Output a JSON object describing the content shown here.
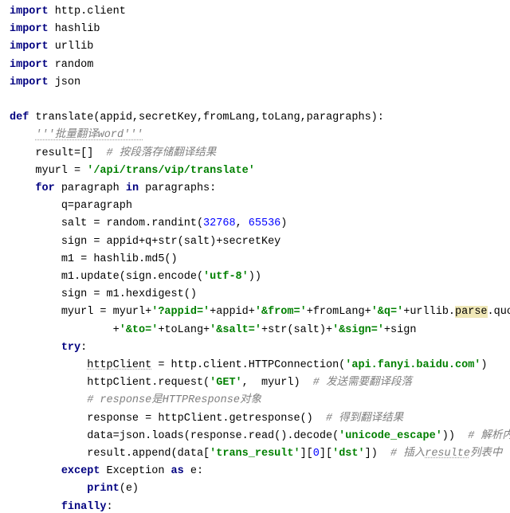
{
  "c": {
    "imp1_kw": "import",
    "imp1_m": " http.client",
    "imp2_kw": "import",
    "imp2_m": " hashlib",
    "imp3_kw": "import",
    "imp3_m": " urllib",
    "imp4_kw": "import",
    "imp4_m": " random",
    "imp5_kw": "import",
    "imp5_m": " json",
    "def_kw": "def",
    "def_sig": " translate(appid,secretKey,fromLang,toLang,paragraphs):",
    "doc": "'''批量翻译word'''",
    "res_l": "result=[]  ",
    "res_c": "# 按段落存储翻译结果",
    "myurl_l": "myurl = ",
    "myurl_s": "'/api/trans/vip/translate'",
    "for_kw": "for",
    "for_mid": " paragraph ",
    "in_kw": "in",
    "for_rest": " paragraphs:",
    "qp": "q=paragraph",
    "salt_l": "salt = random.randint(",
    "salt_n1": "32768",
    "salt_c": ", ",
    "salt_n2": "65536",
    "salt_r": ")",
    "sign1_l": "sign = appid+q+",
    "sign1_str": "str",
    "sign1_r": "(salt)+secretKey",
    "md5": "m1 = hashlib.md5()",
    "upd_l": "m1.update(sign.encode(",
    "upd_s": "'utf-8'",
    "upd_r": "))",
    "hex": "sign = m1.hexdigest()",
    "mu_l": "myurl = myurl+",
    "mu_s1": "'?appid='",
    "mu_a1": "+appid+",
    "mu_s2": "'&from='",
    "mu_a2": "+fromLang+",
    "mu_s3": "'&q='",
    "mu_a3": "+urllib.",
    "mu_hl": "parse",
    "mu_a4": ".quote(q)\\",
    "mu2_pre": "        +",
    "mu2_s1": "'&to='",
    "mu2_a1": "+toLang+",
    "mu2_s2": "'&salt='",
    "mu2_a2": "+",
    "mu2_str": "str",
    "mu2_a3": "(salt)+",
    "mu2_s3": "'&sign='",
    "mu2_a4": "+sign",
    "try_kw": "try",
    "try_c": ":",
    "hc_id": "httpClient",
    "hc_l": " = http.client.HTTPConnection(",
    "hc_s": "'api.fanyi.baidu.com'",
    "hc_r": ")",
    "req_l": "httpClient.request(",
    "req_s": "'GET'",
    "req_m": ",  myurl)  ",
    "req_c": "# 发送需要翻译段落",
    "resp_c": "# response是HTTPResponse对象",
    "resp_l": "response = httpClient.getresponse()  ",
    "resp_cm": "# 得到翻译结果",
    "data_l": "data=json.loads(response.read().decode(",
    "data_s": "'unicode_escape'",
    "data_r": "))  ",
    "data_c": "# 解析内容",
    "app_l": "result.append(data[",
    "app_s": "'trans_result'",
    "app_m": "][",
    "app_n": "0",
    "app_m2": "][",
    "app_s2": "'dst'",
    "app_r": "])  ",
    "app_c1": "# 插入",
    "app_cu": "resulte",
    "app_c2": "列表中",
    "exc_kw": "except",
    "exc_mid": " Exception ",
    "as_kw": "as",
    "exc_r": " e:",
    "pr_kw": "print",
    "pr_r": "(e)",
    "fin_kw": "finally",
    "fin_c": ":"
  }
}
